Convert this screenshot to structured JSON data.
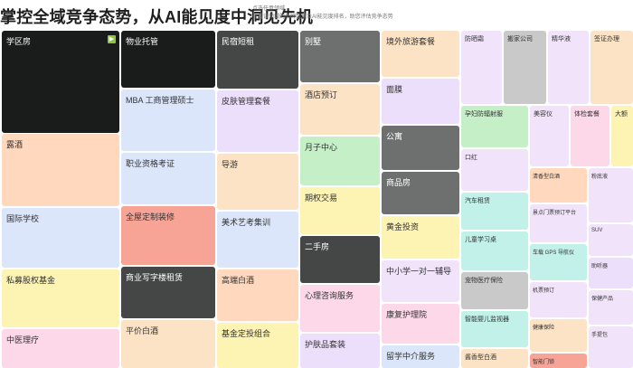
{
  "header": {
    "title": "掌控全域竞争态势，从AI能见度中洞见先机",
    "subtitle_line1": "点选任意领域",
    "subtitle_line2": "查看该领域的品牌数量及AI能见度排名，助您评估竞争态势"
  },
  "colors": {
    "dark": "#1a1c1c",
    "darkgray": "#454747",
    "gray": "#6e7070",
    "peach": "#ffd8bd",
    "blue": "#dbe6fb",
    "yellow": "#fdf3b3",
    "pink": "#fcd8e8",
    "lavender": "#ecdffb",
    "lilac": "#f1e4fa",
    "green": "#c4efc7",
    "lightgray": "#c9c9c9",
    "salmon": "#f7a497",
    "beige": "#fde3c5",
    "teal": "#c1f1e9",
    "accent": "#8cc63f"
  },
  "treemap": {
    "tiles": [
      {
        "id": "xuequfang",
        "label": "学区房"
      },
      {
        "id": "lujiu",
        "label": "露酒"
      },
      {
        "id": "guojixuexiao",
        "label": "国际学校"
      },
      {
        "id": "simuguquanjijin",
        "label": "私募股权基金"
      },
      {
        "id": "zhongyililiao",
        "label": "中医理疗"
      },
      {
        "id": "wuyetuoguan",
        "label": "物业托管"
      },
      {
        "id": "mba",
        "label": "MBA 工商管理硕士"
      },
      {
        "id": "zhiyezigekaozheng",
        "label": "职业资格考证"
      },
      {
        "id": "quanwudingzhizhuangxiu",
        "label": "全屋定制装修"
      },
      {
        "id": "shangyexiezilouzulin",
        "label": "商业写字楼租赁"
      },
      {
        "id": "pingjiabaijiu",
        "label": "平价白酒"
      },
      {
        "id": "minsuduanzu",
        "label": "民宿短租"
      },
      {
        "id": "pifuguanlitaocan",
        "label": "皮肤管理套餐"
      },
      {
        "id": "daoyou",
        "label": "导游"
      },
      {
        "id": "meishuyikaojixun",
        "label": "美术艺考集训"
      },
      {
        "id": "gaoduanbaijiu",
        "label": "高端白酒"
      },
      {
        "id": "jijindingtouzuhe",
        "label": "基金定投组合"
      },
      {
        "id": "bieshu",
        "label": "别墅"
      },
      {
        "id": "jiudianyuding",
        "label": "酒店预订"
      },
      {
        "id": "yuezizhongxin",
        "label": "月子中心"
      },
      {
        "id": "qiquanjiaoyi",
        "label": "期权交易"
      },
      {
        "id": "ershoufang",
        "label": "二手房"
      },
      {
        "id": "xinlizixunfuwu",
        "label": "心理咨询服务"
      },
      {
        "id": "hufupintaozhuang",
        "label": "护肤品套装"
      },
      {
        "id": "jingwailvyoutaocan",
        "label": "境外旅游套餐"
      },
      {
        "id": "mianmo",
        "label": "面膜"
      },
      {
        "id": "gongyu",
        "label": "公寓"
      },
      {
        "id": "shangpinfang",
        "label": "商品房"
      },
      {
        "id": "huangjintouzi",
        "label": "黄金投资"
      },
      {
        "id": "zhongxiaoxue",
        "label": "中小学一对一辅导"
      },
      {
        "id": "kangfuhuliyuan",
        "label": "康复护理院"
      },
      {
        "id": "liuxuezhongjie",
        "label": "留学中介服务"
      },
      {
        "id": "fangshaishuang",
        "label": "防晒霜"
      },
      {
        "id": "yunqifangfushe",
        "label": "孕妇防辐射服"
      },
      {
        "id": "kouhong",
        "label": "口红"
      },
      {
        "id": "qichezulin",
        "label": "汽车租赁"
      },
      {
        "id": "ertongxuexizhuo",
        "label": "儿童学习桌"
      },
      {
        "id": "chongwuyiliaobaoxian",
        "label": "宠物医疗保险"
      },
      {
        "id": "zhinengyingerjianhuqi",
        "label": "智能婴儿监视器"
      },
      {
        "id": "jiangxiangbaijiu",
        "label": "酱香型白酒"
      },
      {
        "id": "banjiagongsi",
        "label": "搬家公司"
      },
      {
        "id": "jinghuaye",
        "label": "精华液"
      },
      {
        "id": "qianzhengbanli",
        "label": "签证办理"
      },
      {
        "id": "meirongyi",
        "label": "美容仪"
      },
      {
        "id": "tijiantaocan",
        "label": "体检套餐"
      },
      {
        "id": "dajian",
        "label": "大额"
      },
      {
        "id": "qingxiangbaijiu",
        "label": "清香型白酒"
      },
      {
        "id": "jingqujipiao",
        "label": "景点门票预订平台"
      },
      {
        "id": "chezaigps",
        "label": "车载 GPS 导航仪"
      },
      {
        "id": "jipiaoyuding",
        "label": "机票预订"
      },
      {
        "id": "jiankangbaoxian",
        "label": "健康保险"
      },
      {
        "id": "wuyebangong",
        "label": "智能门锁"
      },
      {
        "id": "fenmianye",
        "label": "粉底液"
      },
      {
        "id": "suv",
        "label": "SUV"
      },
      {
        "id": "jiankangjiaonang",
        "label": "助听器"
      },
      {
        "id": "baojianchanpin",
        "label": "保健产品"
      },
      {
        "id": "shoutibao",
        "label": "手提包"
      }
    ]
  }
}
